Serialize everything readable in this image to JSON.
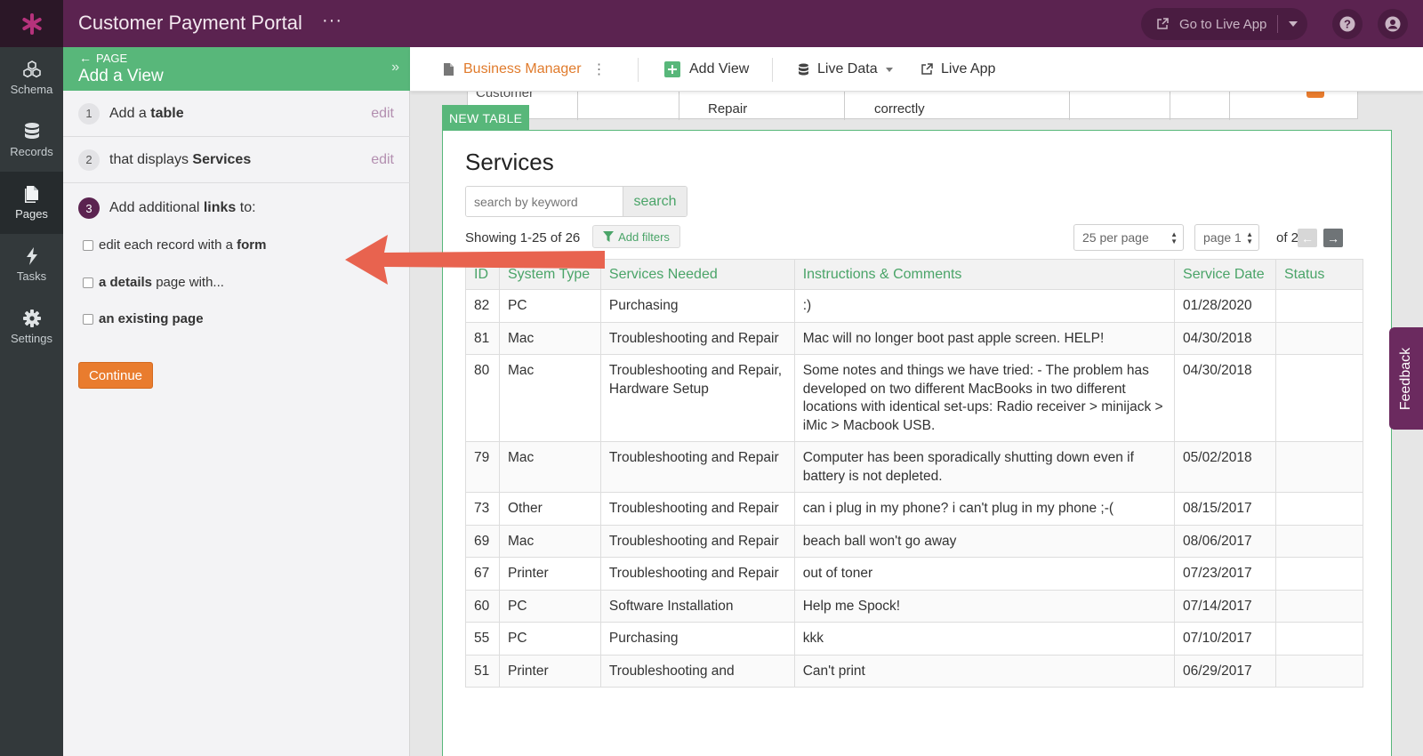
{
  "app": {
    "title": "Customer Payment Portal",
    "more": "···"
  },
  "topbar": {
    "live_app_label": "Go to Live App"
  },
  "nav": {
    "items": [
      {
        "label": "Schema"
      },
      {
        "label": "Records"
      },
      {
        "label": "Pages"
      },
      {
        "label": "Tasks"
      },
      {
        "label": "Settings"
      }
    ]
  },
  "wizard": {
    "kicker": "PAGE",
    "title": "Add a View",
    "steps": [
      {
        "num": "1",
        "text_pre": "Add a ",
        "text_bold": "table",
        "edit": "edit"
      },
      {
        "num": "2",
        "text_pre": "that displays ",
        "text_bold": "Services",
        "edit": "edit"
      },
      {
        "num": "3",
        "text_pre": "Add additional ",
        "text_bold": "links",
        "text_post": " to:"
      }
    ],
    "options": [
      {
        "pre": "edit each record with a ",
        "bold": "form",
        "post": ""
      },
      {
        "pre": "",
        "bold": "a details",
        "post": " page with..."
      },
      {
        "pre": "",
        "bold": "an existing page",
        "post": ""
      }
    ],
    "continue": "Continue"
  },
  "builder": {
    "page_name": "Business Manager",
    "add_view": "Add View",
    "live_data": "Live Data",
    "live_app": "Live App"
  },
  "behind": {
    "cell1": "Customer",
    "cell3": "Repair",
    "cell4": "correctly"
  },
  "table_view": {
    "tag": "NEW TABLE",
    "title": "Services",
    "search_placeholder": "search by keyword",
    "search_button": "search",
    "showing": "Showing 1-25 of 26",
    "add_filters": "Add filters",
    "per_page": "25 per page",
    "page": "page 1",
    "of_pages": "of 2",
    "columns": [
      "ID",
      "System Type",
      "Services Needed",
      "Instructions & Comments",
      "Service Date",
      "Status"
    ],
    "rows": [
      [
        "82",
        "PC",
        "Purchasing",
        ":)",
        "01/28/2020",
        ""
      ],
      [
        "81",
        "Mac",
        "Troubleshooting and Repair",
        "Mac will no longer boot past apple screen. HELP!",
        "04/30/2018",
        ""
      ],
      [
        "80",
        "Mac",
        "Troubleshooting and Repair, Hardware Setup",
        "Some notes and things we have tried: - The problem has developed on two different MacBooks in two different locations with identical set-ups: Radio receiver > minijack > iMic > Macbook USB.",
        "04/30/2018",
        ""
      ],
      [
        "79",
        "Mac",
        "Troubleshooting and Repair",
        "Computer has been sporadically shutting down even if battery is not depleted.",
        "05/02/2018",
        ""
      ],
      [
        "73",
        "Other",
        "Troubleshooting and Repair",
        "can i plug in my phone? i can't plug in my phone ;-(",
        "08/15/2017",
        ""
      ],
      [
        "69",
        "Mac",
        "Troubleshooting and Repair",
        "beach ball won't go away",
        "08/06/2017",
        ""
      ],
      [
        "67",
        "Printer",
        "Troubleshooting and Repair",
        "out of toner",
        "07/23/2017",
        ""
      ],
      [
        "60",
        "PC",
        "Software Installation",
        "Help me Spock!",
        "07/14/2017",
        ""
      ],
      [
        "55",
        "PC",
        "Purchasing",
        "kkk",
        "07/10/2017",
        ""
      ],
      [
        "51",
        "Printer",
        "Troubleshooting and",
        "Can't print",
        "06/29/2017",
        ""
      ]
    ]
  },
  "feedback": "Feedback",
  "colors": {
    "brand": "#5b2350",
    "green": "#58b77a",
    "orange": "#e97c2e",
    "arrow": "#e8634f"
  }
}
